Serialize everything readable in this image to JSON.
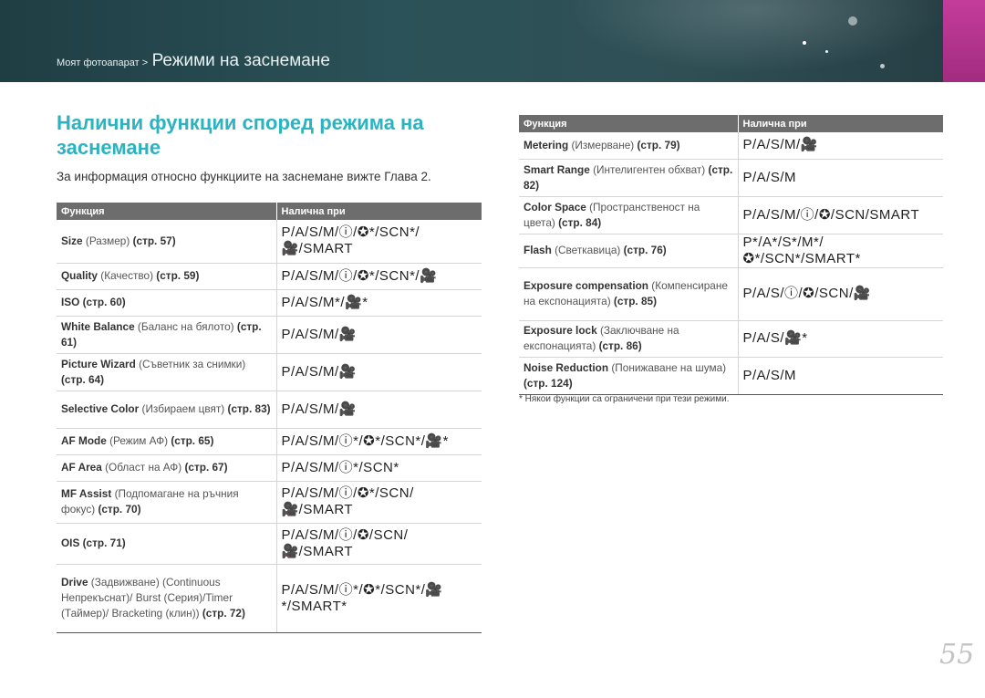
{
  "header": {
    "breadcrumb_small": "Моят фотоапарат >",
    "breadcrumb_big": "Режими на заснемане"
  },
  "title": "Налични функции според режима на заснемане",
  "intro": "За информация относно функциите на заснемане вижте Глава 2.",
  "table_headers": {
    "function": "Функция",
    "available": "Налична при"
  },
  "left_rows": [
    {
      "name": "Size",
      "desc": "(Размер)",
      "ref": "(стр. 57)",
      "modes": "P/A/S/M/ⓘ/✪*/SCN*/🎥/SMART",
      "h": 47
    },
    {
      "name": "Quality",
      "desc": "(Качество)",
      "ref": "(стр. 59)",
      "modes": "P/A/S/M/ⓘ/✪*/SCN*/🎥",
      "h": 29
    },
    {
      "name": "ISO",
      "desc": "",
      "ref": "(стр. 60)",
      "modes": "P/A/S/M*/🎥*",
      "h": 29
    },
    {
      "name": "White Balance",
      "desc": "(Баланс на бялото)",
      "ref": "(стр. 61)",
      "modes": "P/A/S/M/🎥",
      "h": 41
    },
    {
      "name": "Picture Wizard",
      "desc": "(Съветник за снимки)",
      "ref": "(стр. 64)",
      "modes": "P/A/S/M/🎥",
      "h": 41
    },
    {
      "name": "Selective Color",
      "desc": "(Избираем цвят)",
      "ref": "(стр. 83)",
      "modes": "P/A/S/M/🎥",
      "h": 41
    },
    {
      "name": "AF Mode",
      "desc": "(Режим АФ)",
      "ref": "(стр. 65)",
      "modes": "P/A/S/M/ⓘ*/✪*/SCN*/🎥*",
      "h": 29
    },
    {
      "name": "AF Area",
      "desc": "(Област на АФ)",
      "ref": "(стр. 67)",
      "modes": "P/A/S/M/ⓘ*/SCN*",
      "h": 29
    },
    {
      "name": "MF Assist",
      "desc": "(Подпомагане на ръчния фокус)",
      "ref": "(стр. 70)",
      "modes": "P/A/S/M/ⓘ/✪*/SCN/🎥/SMART",
      "h": 46
    },
    {
      "name": "OIS",
      "desc": "",
      "ref": "(стр. 71)",
      "modes": "P/A/S/M/ⓘ/✪/SCN/🎥/SMART",
      "h": 45
    },
    {
      "name": "Drive",
      "desc": "(Задвижване) (Continuous Непрекъснат)/ Burst (Серия)/Timer (Таймер)/ Bracketing (клин))",
      "ref": "(стр. 72)",
      "modes": "P/A/S/M/ⓘ*/✪*/SCN*/🎥*/SMART*",
      "h": 75
    }
  ],
  "right_rows": [
    {
      "name": "Metering",
      "desc": "(Измерване)",
      "ref": "(стр. 79)",
      "modes": "P/A/S/M/🎥",
      "h": 29
    },
    {
      "name": "Smart Range",
      "desc": "(Интелигентен обхват)",
      "ref": "(стр. 82)",
      "modes": "P/A/S/M",
      "h": 41
    },
    {
      "name": "Color Space",
      "desc": "(Пространственост на цвета)",
      "ref": "(стр. 84)",
      "modes": "P/A/S/M/ⓘ/✪/SCN/SMART",
      "h": 41
    },
    {
      "name": "Flash",
      "desc": "(Светкавица)",
      "ref": "(стр. 76)",
      "modes": "P*/A*/S*/M*/✪*/SCN*/SMART*",
      "h": 29
    },
    {
      "name": "Exposure compensation",
      "desc": "(Компенсиране на експонацията)",
      "ref": "(стр. 85)",
      "modes": "P/A/S/ⓘ/✪/SCN/🎥",
      "h": 58
    },
    {
      "name": "Exposure lock",
      "desc": "(Заключване на експонацията)",
      "ref": "(стр. 86)",
      "modes": "P/A/S/🎥*",
      "h": 40
    },
    {
      "name": "Noise Reduction",
      "desc": "(Понижаване на шума)",
      "ref": "(стр. 124)",
      "modes": "P/A/S/M",
      "h": 41
    }
  ],
  "note": "* Някои функции са ограничени при тези режими.",
  "page_number": "55"
}
